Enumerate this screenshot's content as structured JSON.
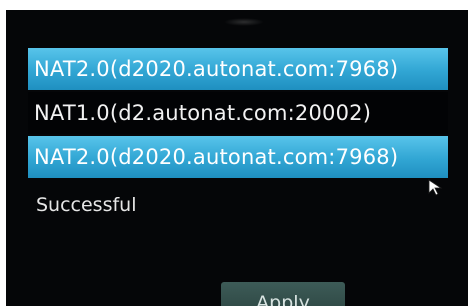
{
  "dropdown": {
    "options": [
      {
        "label": "NAT2.0(d2020.autonat.com:7968)",
        "highlighted": true
      },
      {
        "label": "NAT1.0(d2.autonat.com:20002)",
        "highlighted": false
      },
      {
        "label": "NAT2.0(d2020.autonat.com:7968)",
        "highlighted": true
      }
    ]
  },
  "status": {
    "text": "Successful"
  },
  "buttons": {
    "apply_label": "Apply"
  },
  "colors": {
    "highlight": "#31a6d4",
    "background": "#050608",
    "button": "#34504c"
  },
  "icons": {
    "cursor": "mouse-pointer-icon"
  }
}
